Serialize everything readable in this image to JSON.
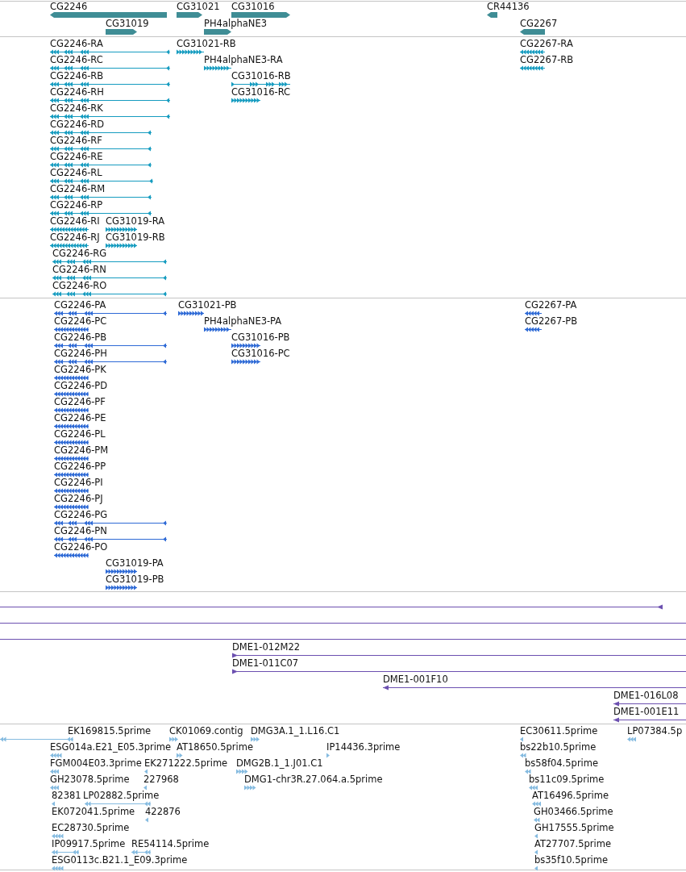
{
  "tracks": [
    {
      "kind": "gene",
      "features": [
        {
          "label": "CG2246",
          "reverse": true
        },
        {
          "label": "CG31021",
          "reverse": false
        },
        {
          "label": "CG31016",
          "reverse": false
        },
        {
          "label": "CR44136",
          "reverse": true
        },
        {
          "label": "CG31019",
          "reverse": false
        },
        {
          "label": "PH4alphaNE3",
          "reverse": false
        },
        {
          "label": "CG2267",
          "reverse": true
        }
      ]
    },
    {
      "kind": "transcript",
      "features": [
        {
          "label": "CG2246-RA",
          "reverse": true
        },
        {
          "label": "CG31021-RB",
          "reverse": false
        },
        {
          "label": "CG2267-RA",
          "reverse": true
        },
        {
          "label": "CG2246-RC",
          "reverse": true
        },
        {
          "label": "PH4alphaNE3-RA",
          "reverse": false
        },
        {
          "label": "CG2267-RB",
          "reverse": true
        },
        {
          "label": "CG2246-RB",
          "reverse": true
        },
        {
          "label": "CG31016-RB",
          "reverse": false
        },
        {
          "label": "CG2246-RH",
          "reverse": true
        },
        {
          "label": "CG31016-RC",
          "reverse": false
        },
        {
          "label": "CG2246-RK",
          "reverse": true
        },
        {
          "label": "CG2246-RD",
          "reverse": true
        },
        {
          "label": "CG2246-RF",
          "reverse": true
        },
        {
          "label": "CG2246-RE",
          "reverse": true
        },
        {
          "label": "CG2246-RL",
          "reverse": true
        },
        {
          "label": "CG2246-RM",
          "reverse": true
        },
        {
          "label": "CG2246-RP",
          "reverse": true
        },
        {
          "label": "CG2246-RI",
          "reverse": true
        },
        {
          "label": "CG31019-RA",
          "reverse": false
        },
        {
          "label": "CG2246-RJ",
          "reverse": true
        },
        {
          "label": "CG31019-RB",
          "reverse": false
        },
        {
          "label": "CG2246-RG",
          "reverse": true
        },
        {
          "label": "CG2246-RN",
          "reverse": true
        },
        {
          "label": "CG2246-RO",
          "reverse": true
        }
      ]
    },
    {
      "kind": "polypeptide",
      "features": [
        {
          "label": "CG2246-PA",
          "reverse": true
        },
        {
          "label": "CG31021-PB",
          "reverse": false
        },
        {
          "label": "CG2267-PA",
          "reverse": true
        },
        {
          "label": "CG2246-PC",
          "reverse": true
        },
        {
          "label": "PH4alphaNE3-PA",
          "reverse": false
        },
        {
          "label": "CG2267-PB",
          "reverse": true
        },
        {
          "label": "CG2246-PB",
          "reverse": true
        },
        {
          "label": "CG31016-PB",
          "reverse": false
        },
        {
          "label": "CG2246-PH",
          "reverse": true
        },
        {
          "label": "CG31016-PC",
          "reverse": false
        },
        {
          "label": "CG2246-PK",
          "reverse": true
        },
        {
          "label": "CG2246-PD",
          "reverse": true
        },
        {
          "label": "CG2246-PF",
          "reverse": true
        },
        {
          "label": "CG2246-PE",
          "reverse": true
        },
        {
          "label": "CG2246-PL",
          "reverse": true
        },
        {
          "label": "CG2246-PM",
          "reverse": true
        },
        {
          "label": "CG2246-PP",
          "reverse": true
        },
        {
          "label": "CG2246-PI",
          "reverse": true
        },
        {
          "label": "CG2246-PJ",
          "reverse": true
        },
        {
          "label": "CG2246-PG",
          "reverse": true
        },
        {
          "label": "CG2246-PN",
          "reverse": true
        },
        {
          "label": "CG2246-PO",
          "reverse": true
        },
        {
          "label": "CG31019-PA",
          "reverse": false
        },
        {
          "label": "CG31019-PB",
          "reverse": false
        }
      ]
    },
    {
      "kind": "clone",
      "features": [
        {
          "kind": "arrow",
          "reverse": true
        },
        {
          "kind": "spanning"
        },
        {
          "kind": "spanning"
        },
        {
          "kind": "arrow",
          "label": "DME1-012M22",
          "reverse": false
        },
        {
          "kind": "arrow",
          "label": "DME1-011C07",
          "reverse": false
        },
        {
          "kind": "arrow",
          "label": "DME1-001F10",
          "reverse": true
        },
        {
          "kind": "arrow",
          "label": "DME1-016L08",
          "reverse": true
        },
        {
          "kind": "arrow",
          "label": "DME1-001E11",
          "reverse": true
        }
      ]
    },
    {
      "kind": "est",
      "features": [
        {
          "label": "EK169815.5prime",
          "reverse": true
        },
        {
          "label": "CK01069.contig",
          "reverse": false
        },
        {
          "label": "DMG3A.1_1.L16.C1",
          "reverse": false
        },
        {
          "label": "EC30611.5prime",
          "reverse": true
        },
        {
          "label": "LP07384.5p",
          "reverse": true
        },
        {
          "label": "ESG014a.E21_E05.3prime",
          "reverse": true
        },
        {
          "label": "AT18650.5prime",
          "reverse": false
        },
        {
          "label": "IP14436.3prime",
          "reverse": false
        },
        {
          "label": "bs22b10.5prime",
          "reverse": true
        },
        {
          "label": "FGM004E03.3prime",
          "reverse": true
        },
        {
          "label": "EK271222.5prime",
          "reverse": true
        },
        {
          "label": "DMG2B.1_1.J01.C1",
          "reverse": false
        },
        {
          "label": "bs58f04.5prime",
          "reverse": true
        },
        {
          "label": "GH23078.5prime",
          "reverse": true
        },
        {
          "label": "227968",
          "reverse": true
        },
        {
          "label": "DMG1-chr3R.27.064.a.5prime",
          "reverse": false
        },
        {
          "label": "bs11c09.5prime",
          "reverse": true
        },
        {
          "label": "82381",
          "reverse": true
        },
        {
          "label": "LP02882.5prime",
          "reverse": true
        },
        {
          "label": "AT16496.5prime",
          "reverse": true
        },
        {
          "label": "EK072041.5prime"
        },
        {
          "label": "422876",
          "reverse": true
        },
        {
          "label": "GH03466.5prime",
          "reverse": true
        },
        {
          "label": "EC28730.5prime",
          "reverse": true
        },
        {
          "label": "GH17555.5prime",
          "reverse": true
        },
        {
          "label": "IP09917.5prime",
          "reverse": true
        },
        {
          "label": "RE54114.5prime",
          "reverse": true
        },
        {
          "label": "AT27707.5prime",
          "reverse": true
        },
        {
          "label": "ESG0113c.B21.1_E09.3prime",
          "reverse": true
        },
        {
          "label": "bs35f10.5prime",
          "reverse": true
        }
      ]
    }
  ]
}
